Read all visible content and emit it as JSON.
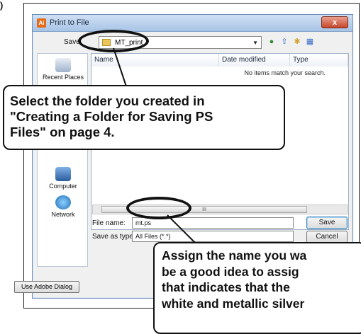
{
  "corner_marker": ")",
  "dialog": {
    "title": "Print to File",
    "title_icon": "Ai",
    "close_label": "x",
    "save_in_label": "Save",
    "save_in_value": "MT_print",
    "columns": [
      "Name",
      "Date modified",
      "Type"
    ],
    "empty_message": "No items match your search.",
    "places": [
      {
        "label": "Recent Places",
        "icon": "recent-places-icon"
      },
      {
        "label": "Computer",
        "icon": "computer-icon"
      },
      {
        "label": "Network",
        "icon": "network-icon"
      }
    ],
    "file_name_label": "File name:",
    "file_name_value": "mt.ps",
    "save_as_type_label": "Save as type:",
    "save_as_type_value": "All Files (*.*)",
    "save_button": "Save",
    "cancel_button": "Cancel",
    "adobe_dialog_button": "Use Adobe Dialog",
    "scroll_mark": "III"
  },
  "callouts": {
    "folder": {
      "lines": [
        "Select the folder you created in",
        "\"Creating a Folder for Saving PS",
        "Files\" on page 4."
      ]
    },
    "filename": {
      "lines": [
        "Assign the name you wa",
        "be a good idea to assig",
        "that indicates that the",
        "white and metallic silver"
      ]
    }
  },
  "colors": {
    "accent": "#111111",
    "title_bar": "#a8c4e6",
    "close_button": "#c7462b"
  }
}
